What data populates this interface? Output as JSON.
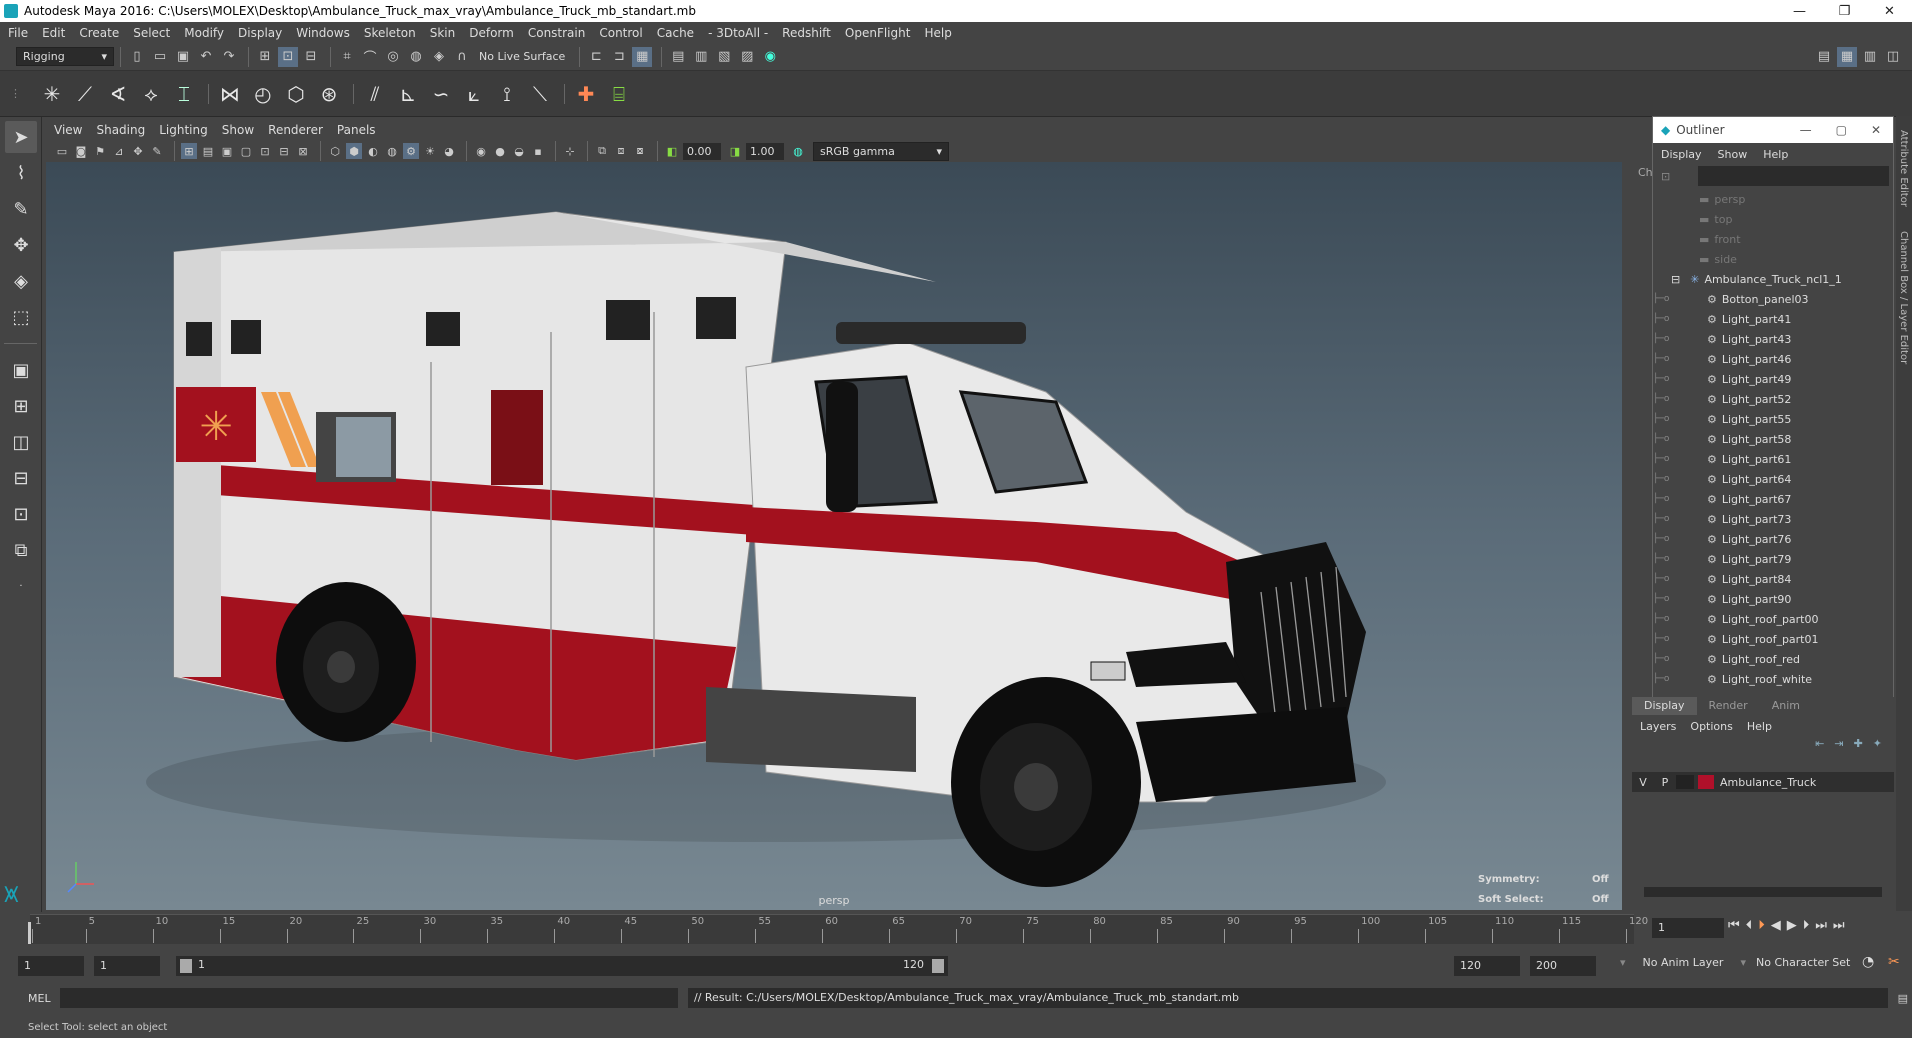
{
  "window": {
    "title": "Autodesk Maya 2016: C:\\Users\\MOLEX\\Desktop\\Ambulance_Truck_max_vray\\Ambulance_Truck_mb_standart.mb",
    "minimize": "—",
    "restore": "❐",
    "close": "✕"
  },
  "menubar": [
    "File",
    "Edit",
    "Create",
    "Select",
    "Modify",
    "Display",
    "Windows",
    "Skeleton",
    "Skin",
    "Deform",
    "Constrain",
    "Control",
    "Cache",
    "- 3DtoAll -",
    "Redshift",
    "OpenFlight",
    "Help"
  ],
  "statusline": {
    "mode": "Rigging",
    "live_surface": "No Live Surface"
  },
  "viewport": {
    "menus": [
      "View",
      "Shading",
      "Lighting",
      "Show",
      "Renderer",
      "Panels"
    ],
    "near_value": "0.00",
    "far_value": "1.00",
    "color_space": "sRGB gamma",
    "camera_label": "persp",
    "hud": {
      "symmetry_label": "Symmetry:",
      "symmetry_value": "Off",
      "soft_select_label": "Soft Select:",
      "soft_select_value": "Off"
    }
  },
  "outliner": {
    "title": "Outliner",
    "menus": [
      "Display",
      "Show",
      "Help"
    ],
    "items": [
      {
        "label": "persp",
        "dim": true,
        "indent": 0
      },
      {
        "label": "top",
        "dim": true,
        "indent": 0
      },
      {
        "label": "front",
        "dim": true,
        "indent": 0
      },
      {
        "label": "side",
        "dim": true,
        "indent": 0
      },
      {
        "label": "Ambulance_Truck_ncl1_1",
        "dim": false,
        "indent": 0,
        "group": true
      },
      {
        "label": "Botton_panel03",
        "indent": 1
      },
      {
        "label": "Light_part41",
        "indent": 1
      },
      {
        "label": "Light_part43",
        "indent": 1
      },
      {
        "label": "Light_part46",
        "indent": 1
      },
      {
        "label": "Light_part49",
        "indent": 1
      },
      {
        "label": "Light_part52",
        "indent": 1
      },
      {
        "label": "Light_part55",
        "indent": 1
      },
      {
        "label": "Light_part58",
        "indent": 1
      },
      {
        "label": "Light_part61",
        "indent": 1
      },
      {
        "label": "Light_part64",
        "indent": 1
      },
      {
        "label": "Light_part67",
        "indent": 1
      },
      {
        "label": "Light_part73",
        "indent": 1
      },
      {
        "label": "Light_part76",
        "indent": 1
      },
      {
        "label": "Light_part79",
        "indent": 1
      },
      {
        "label": "Light_part84",
        "indent": 1
      },
      {
        "label": "Light_part90",
        "indent": 1
      },
      {
        "label": "Light_roof_part00",
        "indent": 1
      },
      {
        "label": "Light_roof_part01",
        "indent": 1
      },
      {
        "label": "Light_roof_red",
        "indent": 1
      },
      {
        "label": "Light_roof_white",
        "indent": 1
      }
    ]
  },
  "channel_box_label": "Ch",
  "side_tabs": {
    "attribute_editor": "Attribute Editor",
    "channel_box": "Channel Box / Layer Editor"
  },
  "layers": {
    "tabs": [
      "Display",
      "Render",
      "Anim"
    ],
    "menus": [
      "Layers",
      "Options",
      "Help"
    ],
    "row": {
      "v": "V",
      "p": "P",
      "name": "Ambulance_Truck",
      "color": "#b0102a"
    }
  },
  "timeline": {
    "ticks": [
      "1",
      "5",
      "10",
      "15",
      "20",
      "25",
      "30",
      "35",
      "40",
      "45",
      "50",
      "55",
      "60",
      "65",
      "70",
      "75",
      "80",
      "85",
      "90",
      "95",
      "100",
      "105",
      "110",
      "115",
      "120"
    ],
    "current_frame": "1"
  },
  "range": {
    "start": "1",
    "playback_start": "1",
    "slider_start": "1",
    "slider_end": "120",
    "playback_end": "120",
    "end": "200",
    "anim_layer": "No Anim Layer",
    "character_set": "No Character Set"
  },
  "command": {
    "lang": "MEL",
    "result": "// Result: C:/Users/MOLEX/Desktop/Ambulance_Truck_max_vray/Ambulance_Truck_mb_standart.mb"
  },
  "help_line": "Select Tool: select an object",
  "colors": {
    "accent": "#1aa3b8",
    "ambulance_red": "#a3111e"
  }
}
